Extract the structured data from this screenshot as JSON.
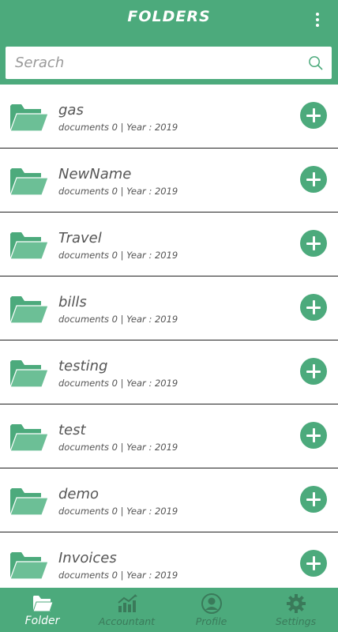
{
  "header": {
    "title": "FOLDERS",
    "menu_icon": "more-vert-icon"
  },
  "search": {
    "placeholder": "Serach",
    "value": "",
    "icon": "search-icon"
  },
  "colors": {
    "primary": "#4caa7c",
    "text": "#555555",
    "nav_inactive": "#3a7a5a"
  },
  "folders": [
    {
      "name": "gas",
      "meta": "documents 0 | Year : 2019"
    },
    {
      "name": "NewName",
      "meta": "documents 0 | Year : 2019"
    },
    {
      "name": "Travel",
      "meta": "documents 0 | Year : 2019"
    },
    {
      "name": "bills",
      "meta": "documents 0 | Year : 2019"
    },
    {
      "name": "testing",
      "meta": "documents 0 | Year : 2019"
    },
    {
      "name": "test",
      "meta": "documents 0 | Year : 2019"
    },
    {
      "name": "demo",
      "meta": "documents 0 | Year : 2019"
    },
    {
      "name": "Invoices",
      "meta": "documents 0 | Year : 2019"
    }
  ],
  "bottom_nav": [
    {
      "label": "Folder",
      "icon": "folder-icon",
      "active": true
    },
    {
      "label": "Accountant",
      "icon": "chart-icon",
      "active": false
    },
    {
      "label": "Profile",
      "icon": "user-icon",
      "active": false
    },
    {
      "label": "Settings",
      "icon": "gear-icon",
      "active": false
    }
  ]
}
